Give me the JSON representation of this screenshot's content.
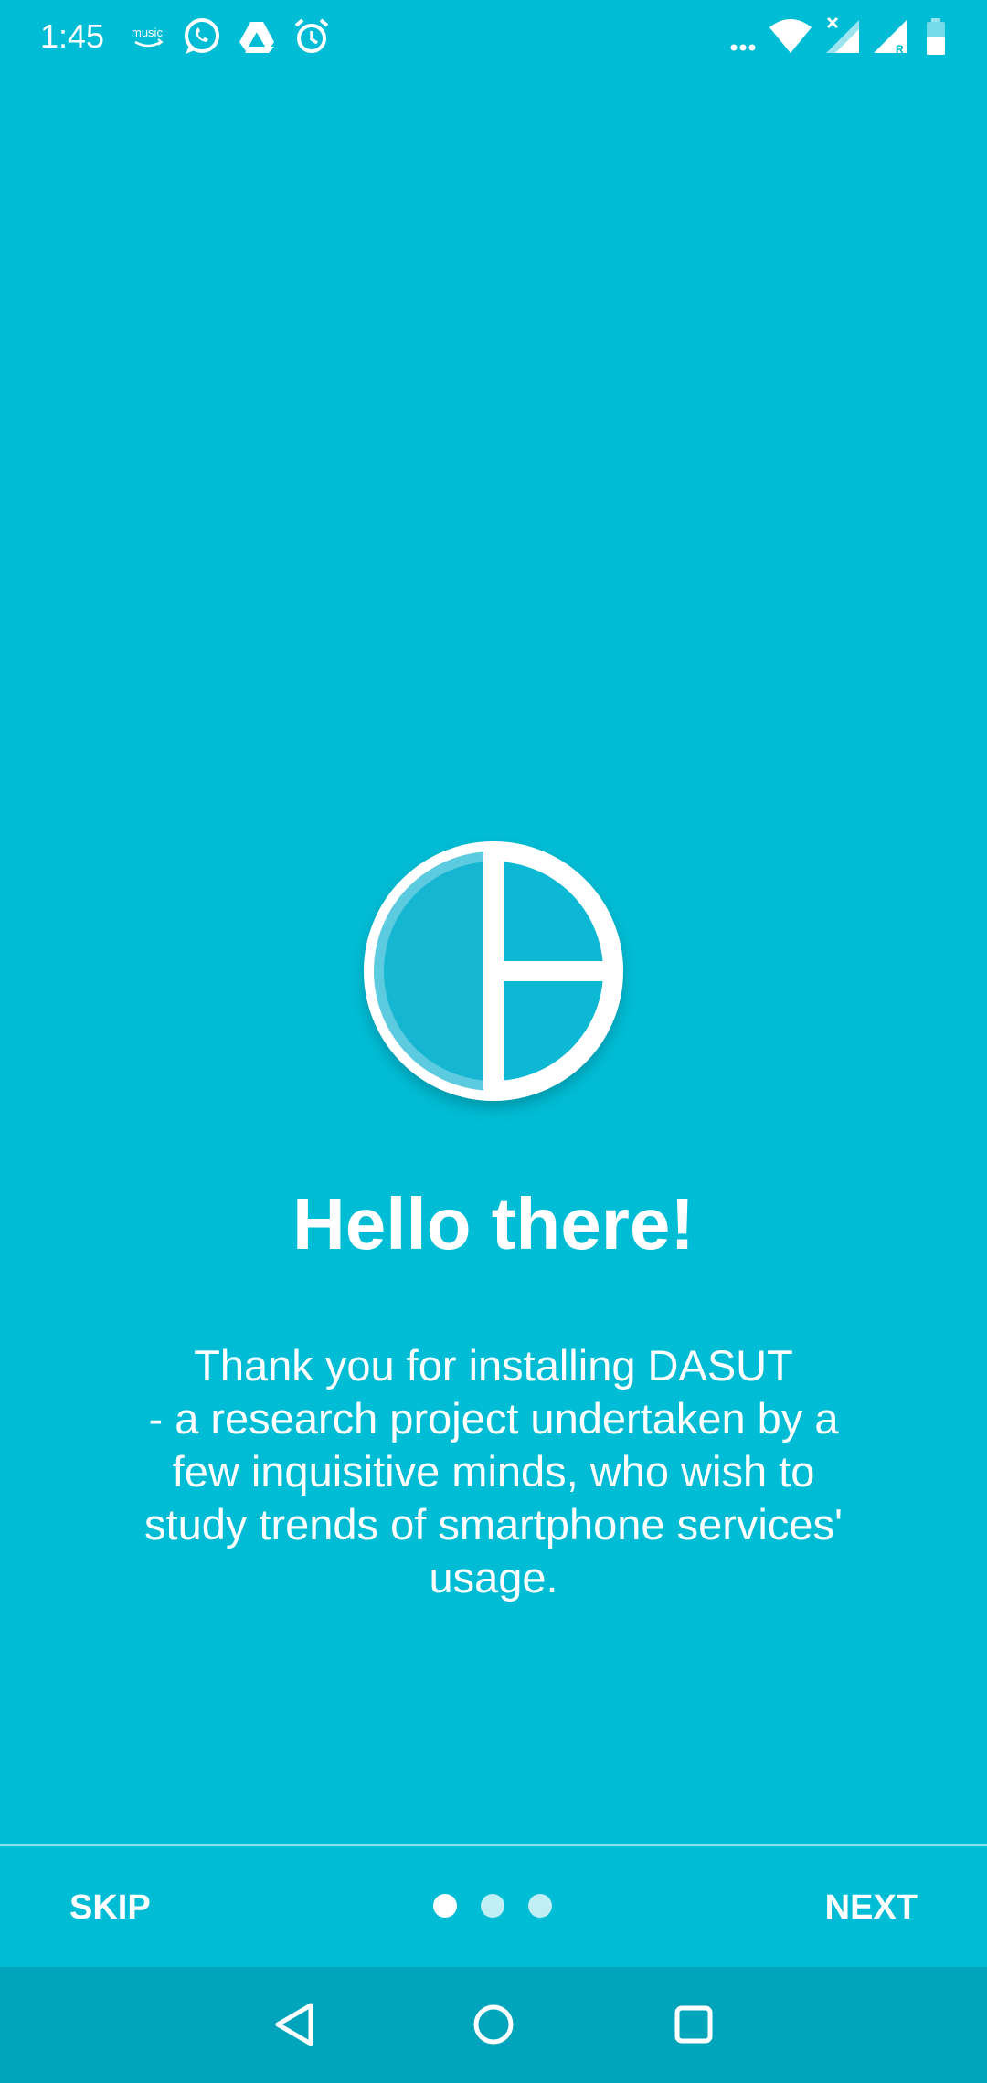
{
  "status_bar": {
    "time": "1:45",
    "notification_icons": [
      "amazon-music-icon",
      "whatsapp-icon",
      "google-drive-icon",
      "alarm-icon"
    ],
    "system_icons": [
      "more-notifications-icon",
      "wifi-icon",
      "signal-no-service-icon",
      "signal-roaming-icon",
      "battery-icon"
    ],
    "music_label": "music"
  },
  "intro": {
    "logo_icon": "dasut-logo-icon",
    "title": "Hello there!",
    "description": "Thank you for installing DASUT\n- a research project undertaken by a\nfew inquisitive minds, who wish to\nstudy trends of smartphone services'\nusage."
  },
  "bottom_bar": {
    "skip_label": "SKIP",
    "next_label": "NEXT",
    "page_indicator": {
      "total": 3,
      "current": 1
    }
  },
  "nav_bar": {
    "buttons": [
      "back-icon",
      "home-icon",
      "recents-icon"
    ]
  },
  "colors": {
    "background": "#00BCD4",
    "nav_bar": "#00A5BC",
    "text": "#FFFFFF"
  }
}
